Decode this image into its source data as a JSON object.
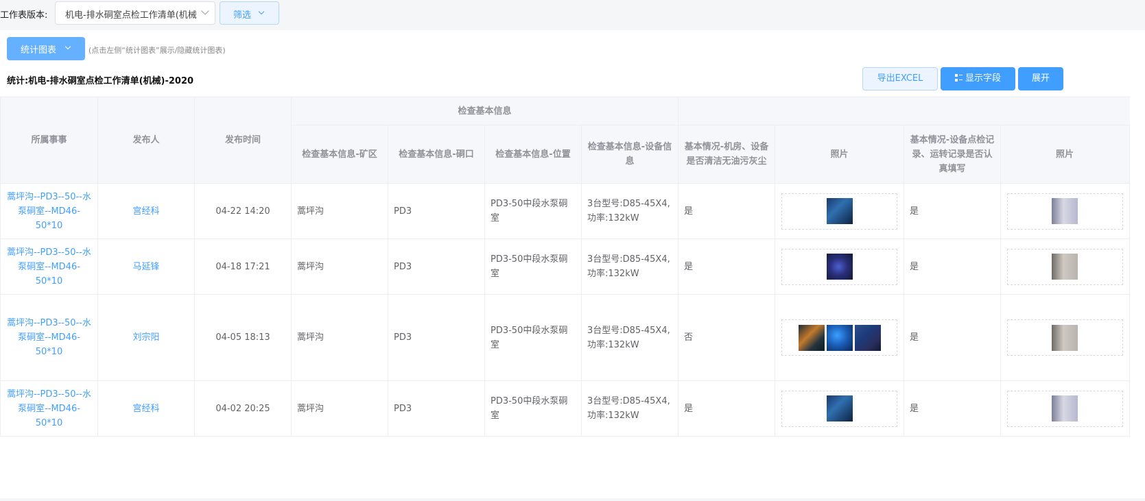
{
  "toolbar": {
    "version_label": "工作表版本:",
    "version_value": "机电-排水硐室点检工作清单(机械",
    "filter_label": "筛选"
  },
  "panel": {
    "stat_button": "统计图表",
    "hint": "(点击左侧“统计图表”展示/隐藏统计图表)",
    "title": "统计:机电-排水硐室点检工作清单(机械)-2020",
    "export_button": "导出EXCEL",
    "fields_button": "显示字段",
    "expand_button": "展开"
  },
  "table": {
    "group_header": "检查基本信息",
    "headers": {
      "event": "所属事事",
      "publisher": "发布人",
      "time": "发布时间",
      "mine": "检查基本信息-矿区",
      "mouth": "检查基本信息-硐口",
      "location": "检查基本信息-位置",
      "device": "检查基本信息-设备信息",
      "clean": "基本情况-机房、设备是否清洁无油污灰尘",
      "photo": "照片",
      "record": "基本情况-设备点检记录、运转记录是否认真填写",
      "photo2": "照片"
    },
    "rows": [
      {
        "event": "蒿坪沟--PD3--50--水泵硐室--MD46-50*10",
        "publisher": "宫经科",
        "time": "04-22 14:20",
        "mine": "蒿坪沟",
        "mouth": "PD3",
        "location": "PD3-50中段水泵硐室",
        "device": "3台型号:D85-45X4,功率:132kW",
        "clean": "是",
        "record": "是"
      },
      {
        "event": "蒿坪沟--PD3--50--水泵硐室--MD46-50*10",
        "publisher": "马延锋",
        "time": "04-18 17:21",
        "mine": "蒿坪沟",
        "mouth": "PD3",
        "location": "PD3-50中段水泵硐室",
        "device": "3台型号:D85-45X4,功率:132kW",
        "clean": "是",
        "record": "是"
      },
      {
        "event": "蒿坪沟--PD3--50--水泵硐室--MD46-50*10",
        "publisher": "刘宗阳",
        "time": "04-05 18:13",
        "mine": "蒿坪沟",
        "mouth": "PD3",
        "location": "PD3-50中段水泵硐室",
        "device": "3台型号:D85-45X4,功率:132kW",
        "clean": "否",
        "record": "是"
      },
      {
        "event": "蒿坪沟--PD3--50--水泵硐室--MD46-50*10",
        "publisher": "宫经科",
        "time": "04-02 20:25",
        "mine": "蒿坪沟",
        "mouth": "PD3",
        "location": "PD3-50中段水泵硐室",
        "device": "3台型号:D85-45X4,功率:132kW",
        "clean": "是",
        "record": "是"
      }
    ]
  },
  "icons": {
    "dropdown": "chevron-down-icon",
    "fields": "fields-icon",
    "thumbnail": "photo-thumbnail"
  },
  "colors": {
    "primary": "#409eff",
    "primary_light": "#66b1ff",
    "header_bg": "#f5f7fa",
    "border": "#ebeef5"
  }
}
